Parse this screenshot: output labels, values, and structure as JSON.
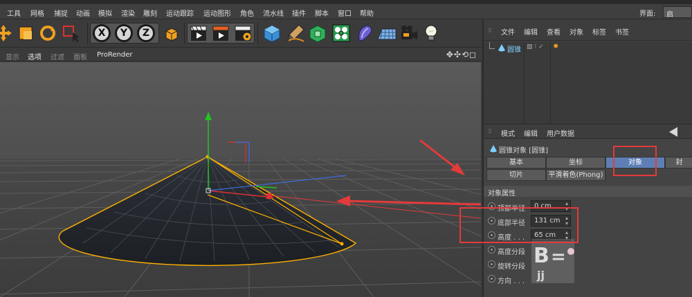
{
  "menubar": {
    "items": [
      "工具",
      "网格",
      "捕捉",
      "动画",
      "模拟",
      "渲染",
      "雕刻",
      "运动跟踪",
      "运动图形",
      "角色",
      "流水线",
      "插件",
      "脚本",
      "窗口",
      "帮助"
    ],
    "layout_label": "界面:",
    "layout_value": "启"
  },
  "toolbar": {
    "axis_buttons": [
      "X",
      "Y",
      "Z"
    ],
    "icons": [
      "move-icon",
      "scale-icon",
      "rotate-icon",
      "select-icon",
      "x-axis-icon",
      "y-axis-icon",
      "z-axis-icon",
      "coordinate-system-icon",
      "render-view-icon",
      "render-picture-viewer-icon",
      "render-settings-icon",
      "cube-icon",
      "pen-icon",
      "subdivision-icon",
      "mograph-cloner-icon",
      "deformer-icon",
      "floor-icon",
      "camera-icon",
      "light-icon"
    ]
  },
  "viewport_header": {
    "menus": [
      "显示",
      "选项",
      "过滤",
      "面板",
      "ProRender"
    ],
    "active": "选项"
  },
  "object_manager": {
    "menus": [
      "文件",
      "编辑",
      "查看",
      "对象",
      "标签",
      "书签"
    ],
    "rows": [
      {
        "name": "圆锥"
      }
    ]
  },
  "attributes": {
    "menus": [
      "模式",
      "编辑",
      "用户数据"
    ],
    "object_title": "圆锥对象 [圆锥]",
    "tabs_row1": [
      "基本",
      "坐标",
      "对象",
      "封"
    ],
    "tabs_row2": [
      "切片",
      "平滑着色(Phong)"
    ],
    "active_tab": "对象",
    "section": "对象属性",
    "props": [
      {
        "label": "顶部半径",
        "value": "0 cm"
      },
      {
        "label": "底部半径",
        "value": "131 cm"
      },
      {
        "label": "高度 . . .",
        "value": "65 cm"
      },
      {
        "label": "高度分段",
        "value": ""
      },
      {
        "label": "旋转分段",
        "value": ""
      },
      {
        "label": "方向 . . .",
        "value": ""
      }
    ]
  },
  "colors": {
    "accent": "#5d7fb5",
    "annotation": "#e53a3a",
    "selection": "#ffb200",
    "y_axis": "#22c422",
    "x_axis": "#e03030",
    "z_axis": "#3a6ee0"
  }
}
